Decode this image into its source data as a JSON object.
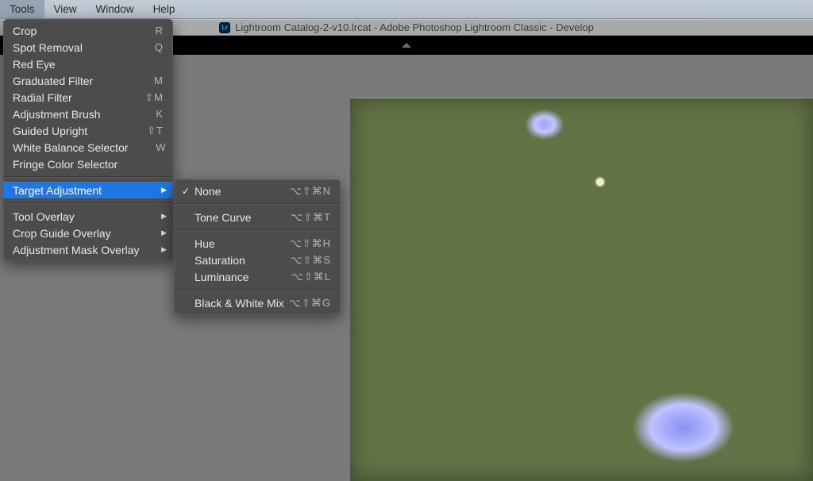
{
  "menubar": {
    "items": [
      "Tools",
      "View",
      "Window",
      "Help"
    ],
    "active_index": 0
  },
  "titlebar": {
    "text": "Lightroom Catalog-2-v10.lrcat - Adobe Photoshop Lightroom Classic - Develop",
    "icon_text": "Lr"
  },
  "tools_menu": {
    "items": [
      {
        "label": "Crop",
        "shortcut": "R",
        "submenu": false
      },
      {
        "label": "Spot Removal",
        "shortcut": "Q",
        "submenu": false
      },
      {
        "label": "Red Eye",
        "shortcut": "",
        "submenu": false
      },
      {
        "label": "Graduated Filter",
        "shortcut": "M",
        "submenu": false
      },
      {
        "label": "Radial Filter",
        "shortcut": "⇧M",
        "submenu": false
      },
      {
        "label": "Adjustment Brush",
        "shortcut": "K",
        "submenu": false
      },
      {
        "label": "Guided Upright",
        "shortcut": "⇧T",
        "submenu": false
      },
      {
        "label": "White Balance Selector",
        "shortcut": "W",
        "submenu": false
      },
      {
        "label": "Fringe Color Selector",
        "shortcut": "",
        "submenu": false
      },
      {
        "sep": true
      },
      {
        "label": "Target Adjustment",
        "shortcut": "",
        "submenu": true,
        "highlight": true
      },
      {
        "sep": true
      },
      {
        "label": "Tool Overlay",
        "shortcut": "",
        "submenu": true
      },
      {
        "label": "Crop Guide Overlay",
        "shortcut": "",
        "submenu": true
      },
      {
        "label": "Adjustment Mask Overlay",
        "shortcut": "",
        "submenu": true
      }
    ]
  },
  "target_submenu": {
    "items": [
      {
        "label": "None",
        "shortcut": "⌥⇧⌘N",
        "checked": true
      },
      {
        "sep": true
      },
      {
        "label": "Tone Curve",
        "shortcut": "⌥⇧⌘T"
      },
      {
        "sep": true
      },
      {
        "label": "Hue",
        "shortcut": "⌥⇧⌘H"
      },
      {
        "label": "Saturation",
        "shortcut": "⌥⇧⌘S"
      },
      {
        "label": "Luminance",
        "shortcut": "⌥⇧⌘L"
      },
      {
        "sep": true
      },
      {
        "label": "Black & White Mix",
        "shortcut": "⌥⇧⌘G"
      }
    ]
  }
}
